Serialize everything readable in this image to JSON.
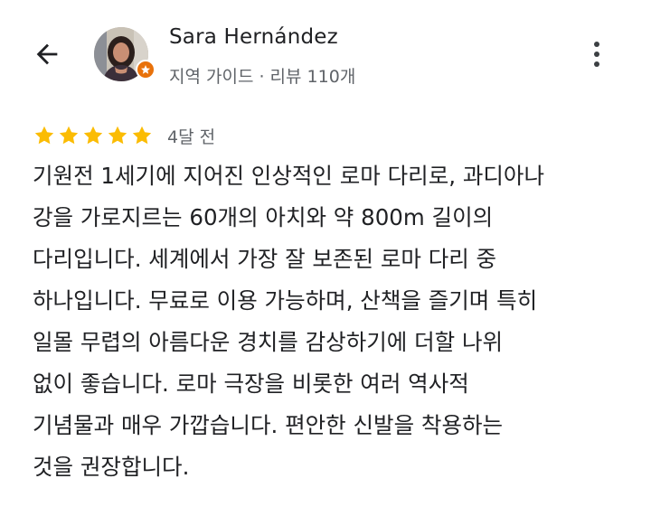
{
  "header": {
    "back_icon": "arrow-back-icon",
    "more_icon": "more-vert-icon",
    "author": {
      "name": "Sara Hernández",
      "meta": "지역 가이드 · 리뷰 110개",
      "badge_icon": "local-guide-star-icon",
      "badge_color": "#e8710a"
    }
  },
  "review": {
    "rating": 5,
    "max_rating": 5,
    "star_color": "#fbbc04",
    "time_ago": "4달 전",
    "lines": [
      "기원전 1세기에 지어진 인상적인 로마 다리로, 과디아나",
      "강을 가로지르는 60개의 아치와 약 800m 길이의",
      "다리입니다. 세계에서 가장 잘 보존된 로마 다리 중",
      "하나입니다. 무료로 이용 가능하며, 산책을 즐기며 특히",
      "일몰 무렵의 아름다운 경치를 감상하기에 더할 나위",
      "없이 좋습니다. 로마 극장을 비롯한 여러 역사적",
      "기념물과 매우 가깝습니다. 편안한 신발을 착용하는",
      "것을 권장합니다."
    ]
  }
}
